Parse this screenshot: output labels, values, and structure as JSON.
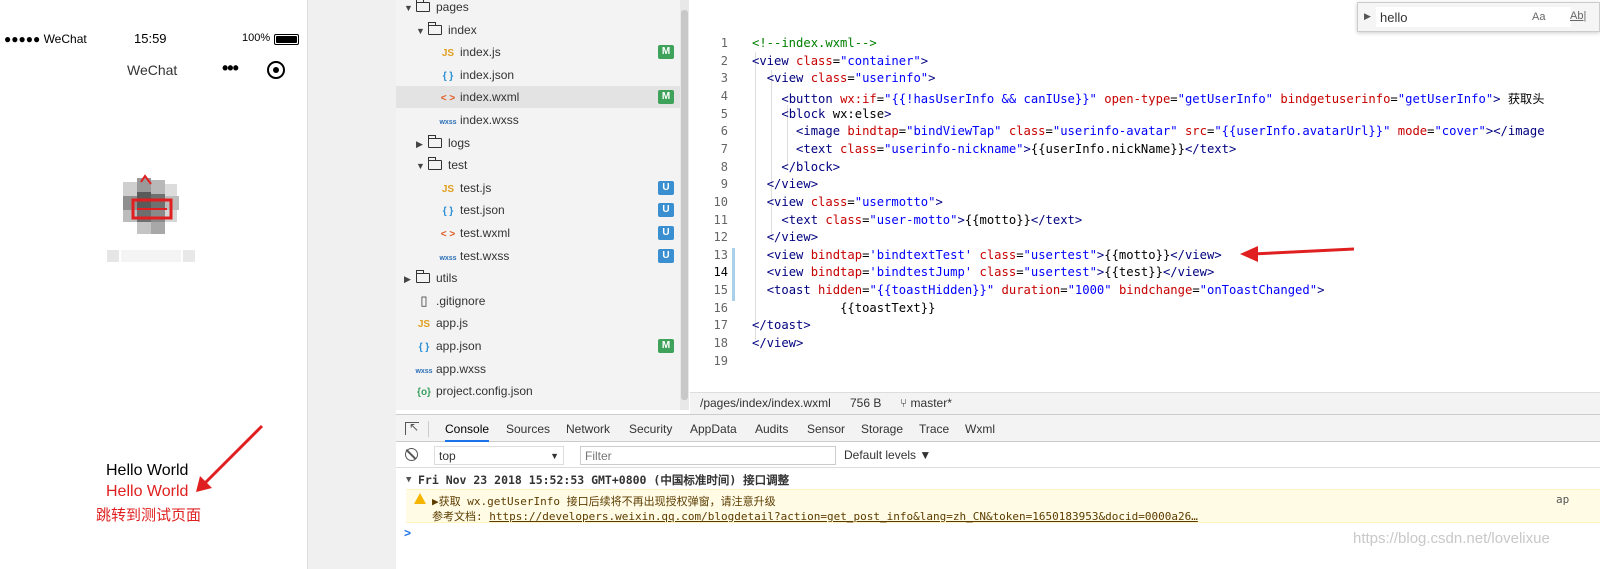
{
  "phone": {
    "status": {
      "carrier": "●●●●● WeChat",
      "time": "15:59",
      "battery": "100%"
    },
    "nav_title": "WeChat",
    "nav_dots": "•••",
    "texts": {
      "hello1": "Hello World",
      "hello2": "Hello World",
      "jump": "跳转到测试页面"
    }
  },
  "tree": {
    "rows": [
      {
        "label": "pages",
        "kind": "folder",
        "expanded": true,
        "badge": ""
      },
      {
        "label": "index",
        "kind": "folder",
        "expanded": true,
        "badge": ""
      },
      {
        "label": "index.js",
        "kind": "js",
        "icon": "JS",
        "badge": "M"
      },
      {
        "label": "index.json",
        "kind": "json",
        "icon": "{ }",
        "badge": ""
      },
      {
        "label": "index.wxml",
        "kind": "wxml",
        "icon": "< >",
        "badge": "M",
        "selected": true
      },
      {
        "label": "index.wxss",
        "kind": "wxss",
        "icon": "wxss",
        "badge": ""
      },
      {
        "label": "logs",
        "kind": "folder",
        "expanded": false,
        "badge": ""
      },
      {
        "label": "test",
        "kind": "folder",
        "expanded": true,
        "badge": ""
      },
      {
        "label": "test.js",
        "kind": "js",
        "icon": "JS",
        "badge": "U"
      },
      {
        "label": "test.json",
        "kind": "json",
        "icon": "{ }",
        "badge": "U"
      },
      {
        "label": "test.wxml",
        "kind": "wxml",
        "icon": "< >",
        "badge": "U"
      },
      {
        "label": "test.wxss",
        "kind": "wxss",
        "icon": "wxss",
        "badge": "U"
      },
      {
        "label": "utils",
        "kind": "folder",
        "expanded": false,
        "badge": ""
      },
      {
        "label": ".gitignore",
        "kind": "file",
        "icon": "",
        "badge": ""
      },
      {
        "label": "app.js",
        "kind": "js",
        "icon": "JS",
        "badge": ""
      },
      {
        "label": "app.json",
        "kind": "json",
        "icon": "{ }",
        "badge": "M"
      },
      {
        "label": "app.wxss",
        "kind": "wxss",
        "icon": "wxss",
        "badge": ""
      },
      {
        "label": "project.config.json",
        "kind": "config",
        "icon": "{o}",
        "badge": ""
      }
    ]
  },
  "editor": {
    "lines": [
      "<!--index.wxml-->",
      "<view class=\"container\">",
      "  <view class=\"userinfo\">",
      "    <button wx:if=\"{{!hasUserInfo && canIUse}}\" open-type=\"getUserInfo\" bindgetuserinfo=\"getUserInfo\"> 获取头",
      "    <block wx:else>",
      "      <image bindtap=\"bindViewTap\" class=\"userinfo-avatar\" src=\"{{userInfo.avatarUrl}}\" mode=\"cover\"></image",
      "      <text class=\"userinfo-nickname\">{{userInfo.nickName}}</text>",
      "    </block>",
      "  </view>",
      "  <view class=\"usermotto\">",
      "    <text class=\"user-motto\">{{motto}}</text>",
      "  </view>",
      "  <view bindtap='bindtextTest' class=\"usertest\">{{motto}}</view>",
      "  <view bindtap='bindtestJump' class=\"usertest\">{{test}}</view>",
      "  <toast hidden=\"{{toastHidden}}\" duration=\"1000\" bindchange=\"onToastChanged\">",
      "            {{toastText}}",
      "</toast>",
      "</view>",
      ""
    ],
    "search": {
      "value": "hello",
      "case_opt": "Aa",
      "word_opt": "Ab|"
    },
    "status": {
      "path": "/pages/index/index.wxml",
      "size": "756 B",
      "branch": "master*"
    }
  },
  "devtools": {
    "tabs": [
      "Console",
      "Sources",
      "Network",
      "Security",
      "AppData",
      "Audits",
      "Sensor",
      "Storage",
      "Trace",
      "Wxml"
    ],
    "active_tab": "Console",
    "context": "top",
    "filter_placeholder": "Filter",
    "levels": "Default levels ▼",
    "group_msg": "Fri Nov 23 2018 15:52:53 GMT+0800 (中国标准时间) 接口调整",
    "warn_line1": "▶获取 wx.getUserInfo 接口后续将不再出现授权弹窗，请注意升级",
    "warn_line2_prefix": "参考文档: ",
    "warn_link": "https://developers.weixin.qq.com/blogdetail?action=get_post_info&lang=zh_CN&token=1650183953&docid=0000a26…",
    "warn_source": "ap",
    "prompt": ">"
  },
  "watermark": "https://blog.csdn.net/lovelixue",
  "colors": {
    "accent_red": "#e02020",
    "badge_modified": "#3fa25a",
    "badge_untracked": "#3a8fd0",
    "tab_active": "#1a73e8"
  }
}
